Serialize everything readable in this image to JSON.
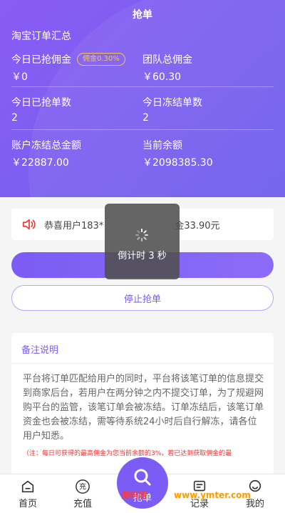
{
  "header": {
    "title": "抢单",
    "section_title": "淘宝订单汇总",
    "stats": {
      "today_commission": {
        "label": "今日已抢佣金",
        "badge": "佣金0.30%",
        "value": "￥0"
      },
      "team_commission": {
        "label": "团队总佣金",
        "value": "￥60.30"
      },
      "today_orders": {
        "label": "今日已抢单数",
        "value": "2"
      },
      "today_frozen": {
        "label": "今日冻结单数",
        "value": "2"
      },
      "frozen_total": {
        "label": "账户冻结总金额",
        "value": "￥22887.00"
      },
      "balance": {
        "label": "当前余额",
        "value": "￥2098385.30"
      }
    }
  },
  "notice": {
    "message_start": "恭喜用户183*",
    "message_end": "金33.90元"
  },
  "toast": {
    "text": "倒计时 3 秒"
  },
  "buttons": {
    "grab_label": "",
    "stop_label": "停止抢单"
  },
  "remark": {
    "title": "备注说明",
    "body": "平台将订单匹配给用户的同时，平台将该笔订单的信息提交到商家后台，若用户在两分钟之内不提交订单，为了规避网购平台的监管，该笔订单会被冻结。订单冻结后，该笔订单资金也会被冻结，需等待系统24小时后自行解冻，请各位用户知悉。",
    "note": "（注：每日可获得的最高佣金为您当前余额的3%，若已达到获取佣金的最"
  },
  "tabbar": {
    "home": "首页",
    "recharge": "充值",
    "grab": "抢单",
    "records": "记录",
    "mine": "我的",
    "recharge_glyph": "充"
  },
  "watermark": {
    "part1": "源码网",
    "part2": "www.ymter.com"
  },
  "colors": {
    "primary": "#7b5cf4",
    "badge": "#f4c45a",
    "note": "#ee3333"
  }
}
